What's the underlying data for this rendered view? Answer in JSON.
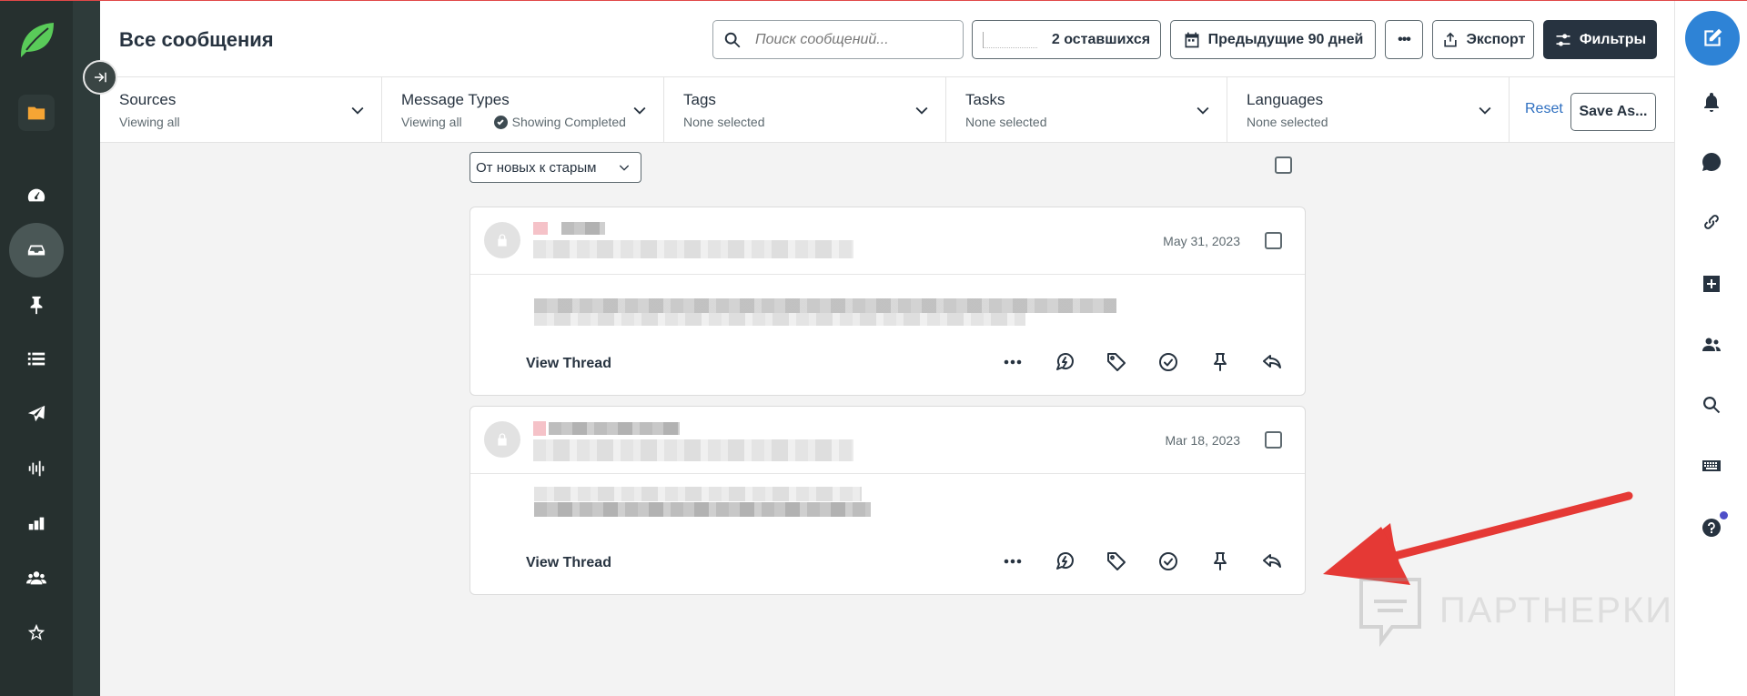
{
  "header": {
    "title": "Все сообщения",
    "search_placeholder": "Поиск сообщений...",
    "remaining_label": "2 оставшихся",
    "period_label": "Предыдущие 90 дней",
    "more_label": "•••",
    "export_label": "Экспорт",
    "filters_label": "Фильтры"
  },
  "filters": [
    {
      "title": "Sources",
      "sub": "Viewing all"
    },
    {
      "title": "Message Types",
      "sub": "Viewing all",
      "extra": "Showing Completed"
    },
    {
      "title": "Tags",
      "sub": "None selected"
    },
    {
      "title": "Tasks",
      "sub": "None selected"
    },
    {
      "title": "Languages",
      "sub": "None selected"
    }
  ],
  "filter_actions": {
    "reset": "Reset",
    "save_as": "Save As..."
  },
  "sort": {
    "selected": "От новых к старым"
  },
  "messages": [
    {
      "date": "May 31, 2023",
      "view_thread": "View Thread"
    },
    {
      "date": "Mar 18, 2023",
      "view_thread": "View Thread"
    }
  ],
  "action_icons": [
    "more-icon",
    "spike-icon",
    "tag-icon",
    "complete-icon",
    "pin-icon",
    "reply-icon"
  ],
  "nav_icons": [
    "folder-icon",
    "dashboard-icon",
    "inbox-icon",
    "pin-icon",
    "list-icon",
    "send-icon",
    "listening-icon",
    "reports-icon",
    "people-icon",
    "star-icon"
  ],
  "right_icons": [
    "compose-icon",
    "bell-icon",
    "spike-icon",
    "link-icon",
    "add-icon",
    "people-icon",
    "search-icon",
    "keyboard-icon",
    "help-icon"
  ],
  "colors": {
    "accent": "#2e83d6",
    "nav": "#26302f",
    "arrow": "#e53935",
    "link": "#2e6fc0"
  },
  "watermark": "ПАРТНЕРКИН"
}
